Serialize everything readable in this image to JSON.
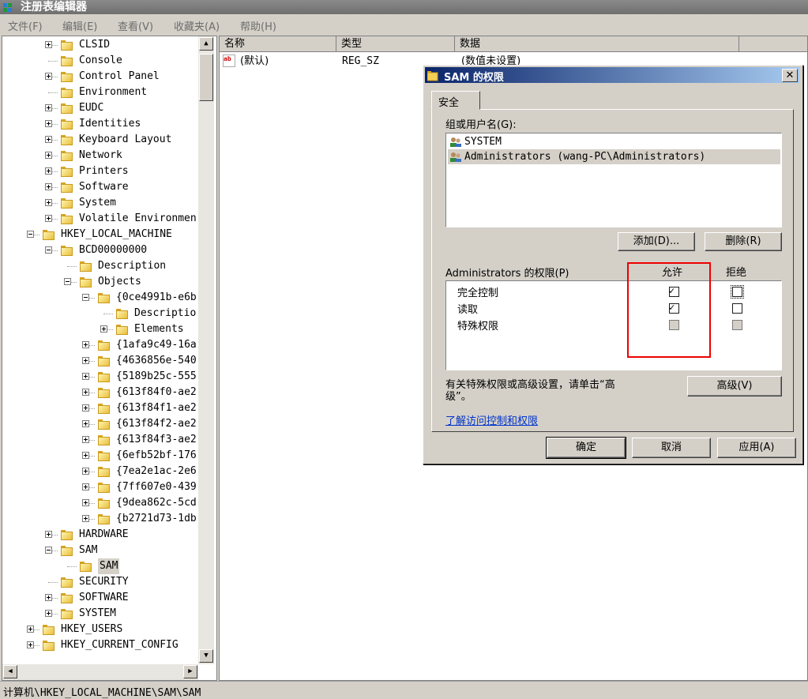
{
  "window": {
    "title": "注册表编辑器"
  },
  "menu": [
    "文件(F)",
    "编辑(E)",
    "查看(V)",
    "收藏夹(A)",
    "帮助(H)"
  ],
  "tree": [
    {
      "label": "CLSID",
      "toggle": "plus"
    },
    {
      "label": "Console",
      "toggle": "none"
    },
    {
      "label": "Control Panel",
      "toggle": "plus"
    },
    {
      "label": "Environment",
      "toggle": "none"
    },
    {
      "label": "EUDC",
      "toggle": "plus"
    },
    {
      "label": "Identities",
      "toggle": "plus"
    },
    {
      "label": "Keyboard Layout",
      "toggle": "plus"
    },
    {
      "label": "Network",
      "toggle": "plus"
    },
    {
      "label": "Printers",
      "toggle": "plus"
    },
    {
      "label": "Software",
      "toggle": "plus"
    },
    {
      "label": "System",
      "toggle": "plus"
    },
    {
      "label": "Volatile Environmen",
      "toggle": "plus"
    },
    {
      "label": "HKEY_LOCAL_MACHINE",
      "toggle": "minus"
    },
    {
      "label": "BCD00000000",
      "toggle": "minus"
    },
    {
      "label": "Description",
      "toggle": "none"
    },
    {
      "label": "Objects",
      "toggle": "minus"
    },
    {
      "label": "{0ce4991b-e6b",
      "toggle": "minus"
    },
    {
      "label": "Descriptio",
      "toggle": "none"
    },
    {
      "label": "Elements",
      "toggle": "plus"
    },
    {
      "label": "{1afa9c49-16a",
      "toggle": "plus"
    },
    {
      "label": "{4636856e-540",
      "toggle": "plus"
    },
    {
      "label": "{5189b25c-555",
      "toggle": "plus"
    },
    {
      "label": "{613f84f0-ae2",
      "toggle": "plus"
    },
    {
      "label": "{613f84f1-ae2",
      "toggle": "plus"
    },
    {
      "label": "{613f84f2-ae2",
      "toggle": "plus"
    },
    {
      "label": "{613f84f3-ae2",
      "toggle": "plus"
    },
    {
      "label": "{6efb52bf-176",
      "toggle": "plus"
    },
    {
      "label": "{7ea2e1ac-2e6",
      "toggle": "plus"
    },
    {
      "label": "{7ff607e0-439",
      "toggle": "plus"
    },
    {
      "label": "{9dea862c-5cd",
      "toggle": "plus"
    },
    {
      "label": "{b2721d73-1db",
      "toggle": "plus"
    },
    {
      "label": "HARDWARE",
      "toggle": "plus"
    },
    {
      "label": "SAM",
      "toggle": "minus"
    },
    {
      "label": "SAM",
      "toggle": "none",
      "selected": true
    },
    {
      "label": "SECURITY",
      "toggle": "none"
    },
    {
      "label": "SOFTWARE",
      "toggle": "plus"
    },
    {
      "label": "SYSTEM",
      "toggle": "plus"
    },
    {
      "label": "HKEY_USERS",
      "toggle": "plus"
    },
    {
      "label": "HKEY_CURRENT_CONFIG",
      "toggle": "plus"
    }
  ],
  "list": {
    "columns": [
      "名称",
      "类型",
      "数据"
    ],
    "rows": [
      {
        "name": "(默认)",
        "type": "REG_SZ",
        "data": "(数值未设置)",
        "icon": "ab-string-icon"
      }
    ]
  },
  "statusbar": "计算机\\HKEY_LOCAL_MACHINE\\SAM\\SAM",
  "dialog": {
    "title": "SAM 的权限",
    "tab": "安全",
    "groups_label": "组或用户名(G):",
    "users": [
      {
        "name": "SYSTEM",
        "selected": false
      },
      {
        "name": "Administrators (wang-PC\\Administrators)",
        "selected": true
      }
    ],
    "add_button": "添加(D)...",
    "remove_button": "删除(R)",
    "perm_label": "Administrators 的权限(P)",
    "allow_header": "允许",
    "deny_header": "拒绝",
    "permissions": [
      {
        "name": "完全控制",
        "allow": "checked",
        "deny": "unchecked"
      },
      {
        "name": "读取",
        "allow": "checked",
        "deny": "unchecked"
      },
      {
        "name": "特殊权限",
        "allow": "disabled",
        "deny": "disabled"
      }
    ],
    "advanced_text_1": "有关特殊权限或高级设置，请单击“高",
    "advanced_text_2": "级”。",
    "advanced_button": "高级(V)",
    "link": "了解访问控制和权限",
    "ok": "确定",
    "cancel": "取消",
    "apply": "应用(A)"
  },
  "colors": {
    "highlight_box": "#e00000",
    "title_gradient_start": "#0a246a",
    "link": "#0033cc"
  }
}
